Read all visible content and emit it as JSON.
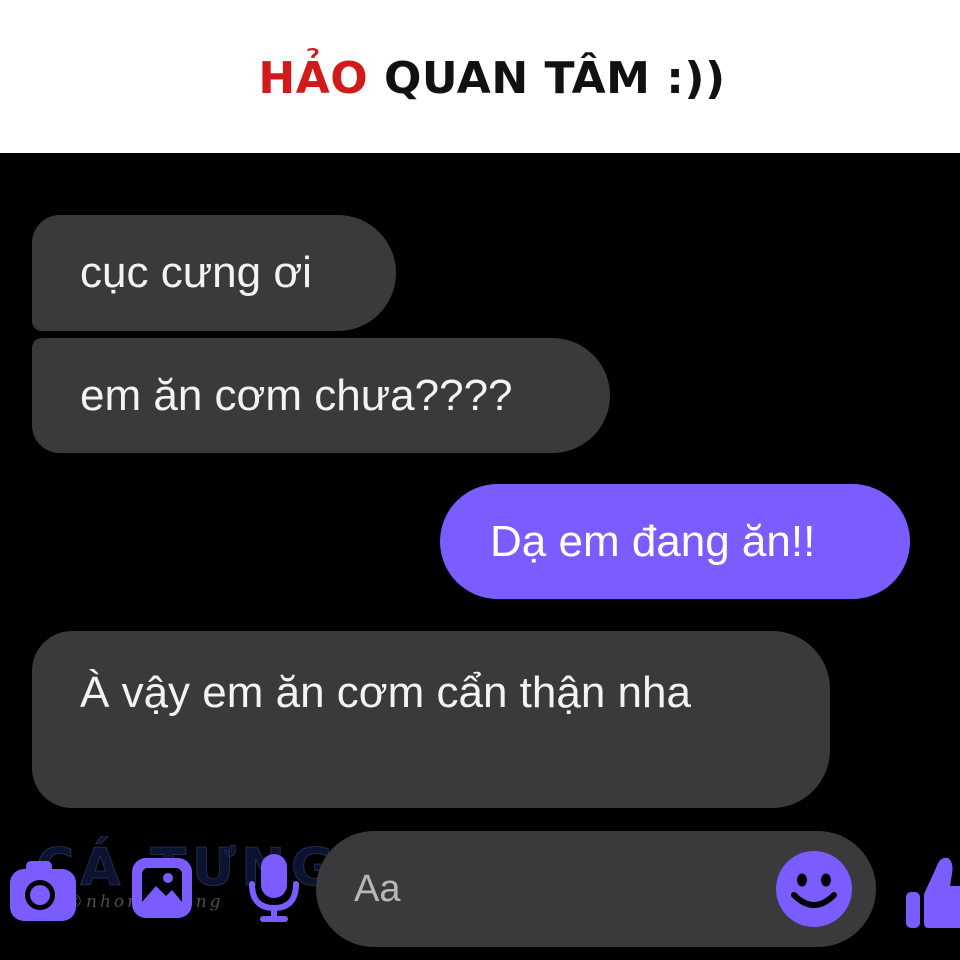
{
  "headline": {
    "highlight": "HẢO",
    "rest": " QUAN TÂM :))"
  },
  "messages": [
    {
      "sender": "other",
      "text": "cục cưng ơi"
    },
    {
      "sender": "other",
      "text": "em ăn cơm chưa????"
    },
    {
      "sender": "me",
      "text": "Dạ em đang ăn!!"
    },
    {
      "sender": "other",
      "text": "À vậy em ăn cơm cẩn thận nha"
    }
  ],
  "composer": {
    "placeholder": "Aa"
  },
  "toolbar": {
    "icons": [
      "camera-icon",
      "image-icon",
      "microphone-icon",
      "emoji-icon",
      "thumbs-up-icon"
    ]
  },
  "watermark": {
    "logo": "CÁ TƯNG",
    "handle": "©nhomcatung"
  },
  "colors": {
    "background": "#000000",
    "incoming_bubble": "#3a3a3c",
    "outgoing_bubble": "#7b5cff",
    "accent": "#7b5cff",
    "headline_highlight": "#d11a1a"
  }
}
